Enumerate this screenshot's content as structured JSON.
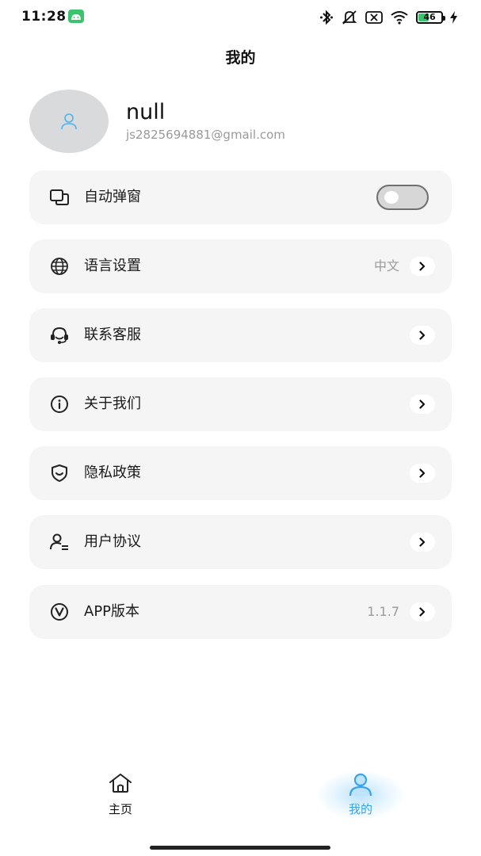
{
  "status_bar": {
    "time": "11:28",
    "battery_level": "46",
    "battery_fraction": 0.46
  },
  "header": {
    "title": "我的"
  },
  "profile": {
    "name": "null",
    "email": "js2825694881@gmail.com"
  },
  "menu": {
    "auto_popup": {
      "label": "自动弹窗",
      "icon": "window-icon",
      "toggle_on": false
    },
    "language": {
      "label": "语言设置",
      "value": "中文",
      "icon": "globe-icon"
    },
    "support": {
      "label": "联系客服",
      "icon": "headset-icon"
    },
    "about": {
      "label": "关于我们",
      "icon": "info-icon"
    },
    "privacy": {
      "label": "隐私政策",
      "icon": "shield-icon"
    },
    "agreement": {
      "label": "用户协议",
      "icon": "user-doc-icon"
    },
    "version": {
      "label": "APP版本",
      "value": "1.1.7",
      "icon": "version-icon"
    }
  },
  "tab_bar": {
    "home": {
      "label": "主页",
      "icon": "home-icon"
    },
    "mine": {
      "label": "我的",
      "icon": "user-icon",
      "active": true
    }
  },
  "colors": {
    "accent": "#3aa3e8",
    "card_bg": "#f5f5f5",
    "muted_text": "#9a9a9a"
  }
}
